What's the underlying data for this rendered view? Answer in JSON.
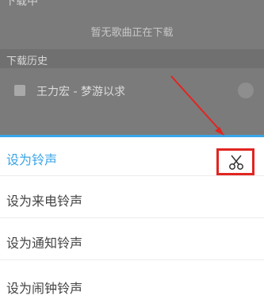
{
  "background": {
    "top_text": "下载中",
    "empty_text": "暂无歌曲正在下载",
    "history_title": "下载历史",
    "history_item": "王力宏 - 梦游以求"
  },
  "sheet": {
    "items": [
      {
        "label": "设为铃声",
        "active": true
      },
      {
        "label": "设为来电铃声"
      },
      {
        "label": "设为通知铃声"
      },
      {
        "label": "设为闹钟铃声"
      }
    ],
    "accent_color": "#3aa4e6",
    "highlight_color": "#e12521"
  }
}
